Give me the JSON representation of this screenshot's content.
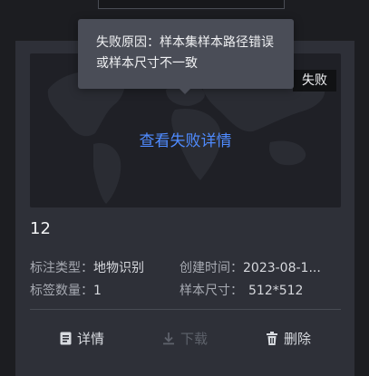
{
  "tooltip": {
    "text": "失败原因：样本集样本路径错误或样本尺寸不一致"
  },
  "card": {
    "status_tag": "失败",
    "view_fail_link": "查看失败详情",
    "name": "12",
    "annotation_type_label": "标注类型：",
    "annotation_type_value": "地物识别",
    "created_time_label": "创建时间：",
    "created_time_value": "2023-08-1...",
    "label_count_label": "标签数量：",
    "label_count_value": "1",
    "sample_size_label": "样本尺寸：",
    "sample_size_value": "512*512"
  },
  "actions": {
    "detail_label": "详情",
    "download_label": "下载",
    "delete_label": "删除"
  },
  "colors": {
    "link": "#4f8bff",
    "card_bg": "#2e3038",
    "page_bg": "#1c1d21",
    "tooltip_bg": "#4a4d57"
  }
}
